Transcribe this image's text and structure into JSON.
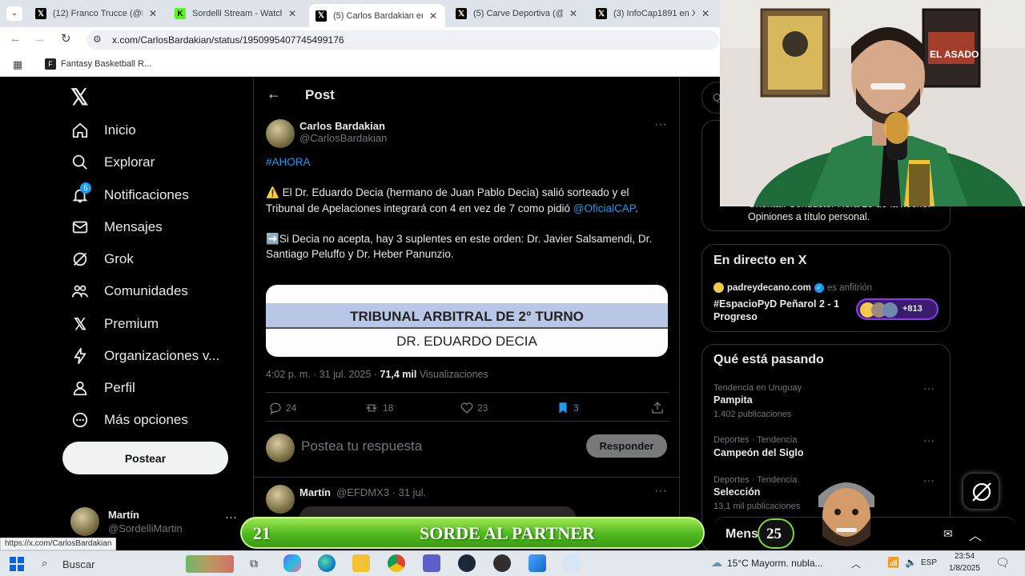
{
  "browser": {
    "tabs": [
      {
        "label": "(12) Franco Trucce (@F",
        "favicon": "X",
        "active": false
      },
      {
        "label": "Sordelli Stream - Watch",
        "favicon": "K",
        "active": false
      },
      {
        "label": "(5) Carlos Bardakian en",
        "favicon": "X",
        "active": true
      },
      {
        "label": "(5) Carve Deportiva (@",
        "favicon": "X",
        "active": false
      },
      {
        "label": "(3) InfoCap1891 en X: \"",
        "favicon": "X",
        "active": false
      }
    ],
    "url": "x.com/CarlosBardakian/status/1950995407745499176",
    "bookmark": "Fantasy Basketball R...",
    "status_url": "https://x.com/CarlosBardakian"
  },
  "sidebar": {
    "items": [
      {
        "label": "Inicio",
        "icon": "home-icon"
      },
      {
        "label": "Explorar",
        "icon": "search-icon"
      },
      {
        "label": "Notificaciones",
        "icon": "bell-icon",
        "badge": "5"
      },
      {
        "label": "Mensajes",
        "icon": "mail-icon"
      },
      {
        "label": "Grok",
        "icon": "grok-icon"
      },
      {
        "label": "Comunidades",
        "icon": "people-icon"
      },
      {
        "label": "Premium",
        "icon": "x-logo-icon"
      },
      {
        "label": "Organizaciones v...",
        "icon": "lightning-icon"
      },
      {
        "label": "Perfil",
        "icon": "person-icon"
      },
      {
        "label": "Más opciones",
        "icon": "more-circle-icon"
      }
    ],
    "post_button": "Postear",
    "account": {
      "name": "Martín",
      "handle": "@SordelliMartin"
    }
  },
  "post": {
    "header": "Post",
    "author_name": "Carlos Bardakian",
    "author_handle": "@CarlosBardakian",
    "hashtag": "#AHORA",
    "para1_emoji": "⚠️",
    "para1": "El Dr. Eduardo Decia (hermano de Juan Pablo Decia) salió sorteado y el Tribunal de Apelaciones integrará con 4 en vez de 7 como pidió",
    "mention": "@OficialCAP",
    "para1_end": ".",
    "para2_emoji": "➡️",
    "para2": "Si Decia no acepta, hay 3 suplentes en este orden:  Dr. Javier Salsamendi, Dr. Santiago Peluffo y Dr. Heber Panunzio.",
    "image_line1": "TRIBUNAL ARBITRAL DE 2° TURNO",
    "image_line2": "DR. EDUARDO DECIA",
    "timestamp": "4:02 p. m. · 31 jul. 2025 · ",
    "views_count": "71,4 mil",
    "views_label": "Visualizaciones",
    "replies": "24",
    "reposts": "18",
    "likes": "23",
    "bookmarks": "3",
    "reply_placeholder": "Postea tu respuesta",
    "reply_button": "Responder"
  },
  "reply": {
    "name": "Martín",
    "meta": "@EFDMX3 · 31 jul."
  },
  "right": {
    "search_letter": "Q",
    "profile_text": "Oriental. Conductor Hora 25 de la noche. Opiniones a título personal.",
    "live": {
      "title": "En directo en X",
      "host": "padreydecano.com",
      "host_suffix": "es anfitrión",
      "space_title": "#EspacioPyD Peñarol 2 - 1 Progreso",
      "listeners": "+813"
    },
    "trends_title": "Qué está pasando",
    "trends": [
      {
        "context": "Tendencia en Uruguay",
        "name": "Pampita",
        "count": "1.402 publicaciones"
      },
      {
        "context": "Deportes · Tendencia",
        "name": "Campeón del Siglo",
        "count": ""
      },
      {
        "context": "Deportes · Tendencia",
        "name": "Selección",
        "count": "13,1 mil publicaciones"
      }
    ],
    "messages_label": "Mensajes"
  },
  "overlay": {
    "number": "21",
    "text": "SORDE AL PARTNER",
    "mensajes_overlap": "25"
  },
  "taskbar": {
    "search": "Buscar",
    "weather": "15°C  Mayorm. nubla...",
    "lang": "ESP",
    "time": "23:54",
    "date": "1/8/2025"
  },
  "colors": {
    "accent": "#1d9bf0",
    "background": "#000000",
    "banner_green": "#4fb81e"
  }
}
